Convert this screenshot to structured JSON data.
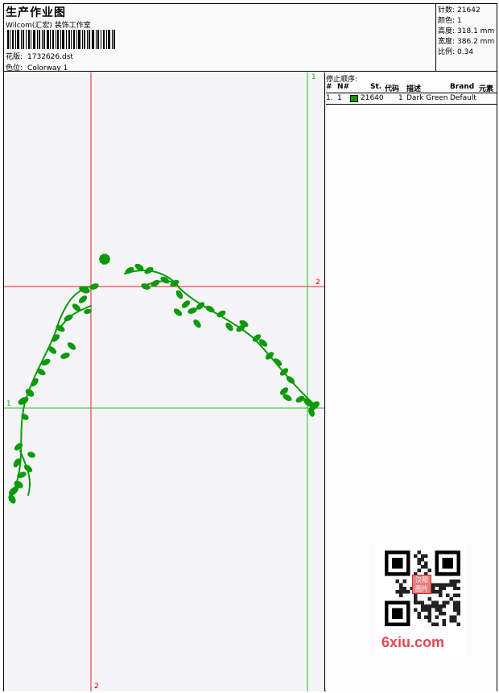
{
  "header": {
    "title": "生产作业图",
    "subtitle": "Wilcom(汇宏) 装饰工作室",
    "design_label": "花版:",
    "design_value": "1732626.dst",
    "color_label": "色位:",
    "color_value": "Colorway 1"
  },
  "stats": [
    {
      "label": "针数:",
      "value": "21642"
    },
    {
      "label": "颜色:",
      "value": "1"
    },
    {
      "label": "高度:",
      "value": "318.1 mm"
    },
    {
      "label": "宽度:",
      "value": "386.2 mm"
    },
    {
      "label": "比例:",
      "value": "0.34"
    }
  ],
  "axes": {
    "top_green": "1",
    "right_red": "2",
    "left_green": "1",
    "bottom_red": "2"
  },
  "stop_sequence": {
    "title": "停止顺序:",
    "columns": [
      "#",
      "N#",
      "St.",
      "代码",
      "描述",
      "Brand",
      "元素"
    ],
    "rows": [
      {
        "index": "1.",
        "needle": "1",
        "stitches": "21640",
        "code": "1",
        "description": "Dark Green",
        "brand": "Default",
        "color": "#0a9a0a"
      }
    ]
  },
  "colors": {
    "thread": "#0a9a0a",
    "red_guide": "#e02020",
    "green_guide": "#20c020",
    "watermark": "#e04850"
  },
  "watermark": {
    "stamp_text": "汉阳图片",
    "logo_text": "6xiu.com"
  }
}
